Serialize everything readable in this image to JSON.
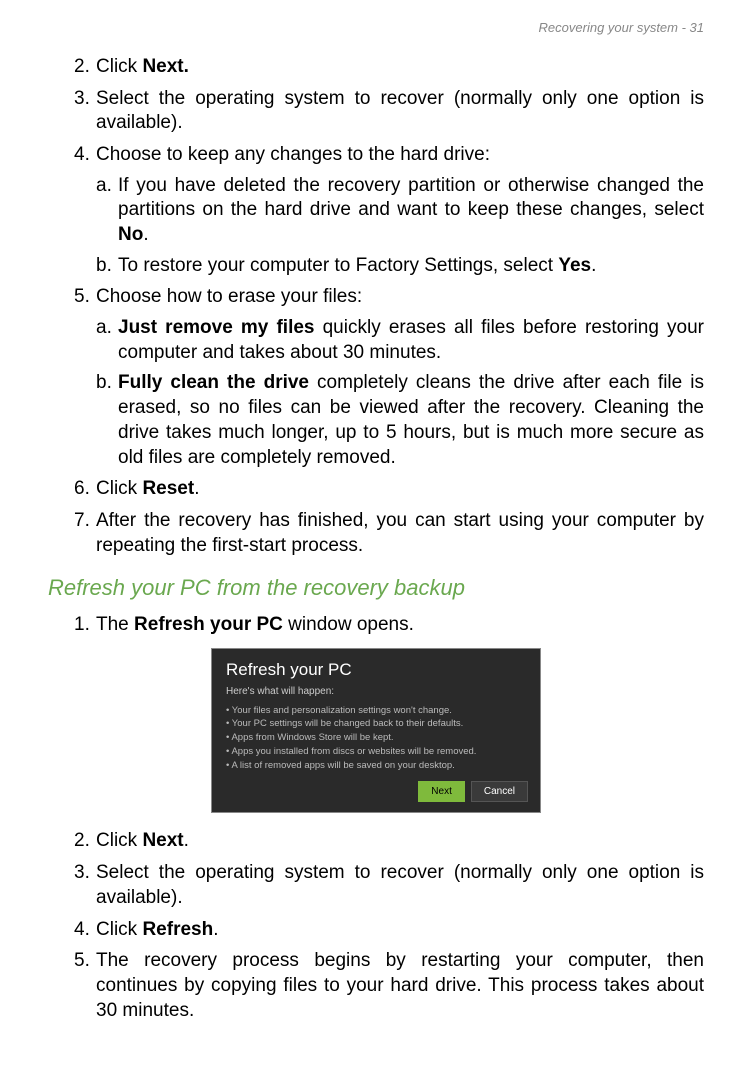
{
  "header": "Recovering your system - 31",
  "steps1": {
    "s2": {
      "num": "2.",
      "a": "Click ",
      "b": "Next."
    },
    "s3": {
      "num": "3.",
      "t": "Select the operating system to recover (normally only one option is available)."
    },
    "s4": {
      "num": "4.",
      "t": "Choose to keep any changes to the hard drive:",
      "a": {
        "let": "a.",
        "t1": "If you have deleted the recovery partition or otherwise changed the partitions on the hard drive and want to keep these changes, select ",
        "b": "No",
        "t2": "."
      },
      "b": {
        "let": "b.",
        "t1": "To restore your computer to Factory Settings, select ",
        "b": "Yes",
        "t2": "."
      }
    },
    "s5": {
      "num": "5.",
      "t": "Choose how to erase your files:",
      "a": {
        "let": "a.",
        "b": "Just remove my files",
        "t": " quickly erases all files before restoring your computer and takes about 30 minutes."
      },
      "b": {
        "let": "b.",
        "b": "Fully clean the drive",
        "t": " completely cleans the drive after each file is erased, so no files can be viewed after the recovery. Cleaning the drive takes much longer, up to 5 hours, but is much more secure as old files are completely removed."
      }
    },
    "s6": {
      "num": "6.",
      "a": "Click ",
      "b": "Reset",
      "c": "."
    },
    "s7": {
      "num": "7.",
      "t": "After the recovery has finished, you can start using your computer by repeating the first-start process."
    }
  },
  "section_title": "Refresh your PC from the recovery backup",
  "steps2": {
    "s1": {
      "num": "1.",
      "a": "The ",
      "b": "Refresh your PC",
      "c": " window opens."
    },
    "s2": {
      "num": "2.",
      "a": "Click ",
      "b": "Next",
      "c": "."
    },
    "s3": {
      "num": "3.",
      "t": "Select the operating system to recover (normally only one option is available)."
    },
    "s4": {
      "num": "4.",
      "a": "Click ",
      "b": "Refresh",
      "c": "."
    },
    "s5": {
      "num": "5.",
      "t": "The recovery process begins by restarting your computer, then continues by copying files to your hard drive. This process takes about 30 minutes."
    }
  },
  "figure": {
    "title": "Refresh your PC",
    "sub": "Here's what will happen:",
    "b1": "Your files and personalization settings won't change.",
    "b2": "Your PC settings will be changed back to their defaults.",
    "b3": "Apps from Windows Store will be kept.",
    "b4": "Apps you installed from discs or websites will be removed.",
    "b5": "A list of removed apps will be saved on your desktop.",
    "next": "Next",
    "cancel": "Cancel"
  }
}
